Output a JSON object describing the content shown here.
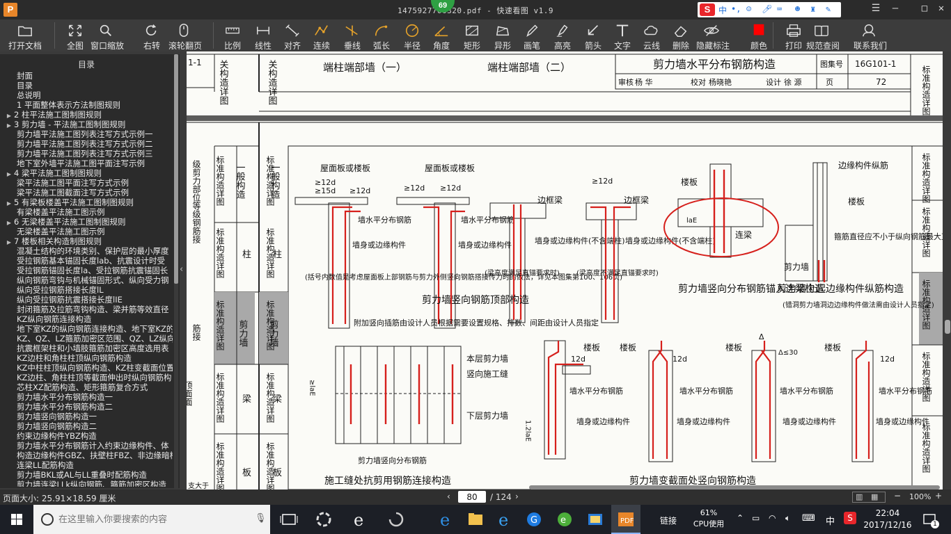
{
  "titlebar": {
    "title": "1475927706320.pdf - 快速看图 v1.9",
    "badge": "69",
    "ime_label": "中",
    "ime_punct": "•,"
  },
  "toolbar": {
    "buttons": [
      {
        "id": "open",
        "label": "打开文档",
        "icon": "folder-icon"
      },
      {
        "id": "fit",
        "label": "全图",
        "icon": "fullscreen-icon"
      },
      {
        "id": "zoomwin",
        "label": "窗口缩放",
        "icon": "magnifier-icon"
      },
      {
        "id": "rotate",
        "label": "右转",
        "icon": "rotate-icon"
      },
      {
        "id": "wheel",
        "label": "滚轮翻页",
        "icon": "mouse-icon"
      },
      {
        "id": "scale",
        "label": "比例",
        "icon": "ruler-icon"
      },
      {
        "id": "linear",
        "label": "线性",
        "icon": "linear-dim-icon"
      },
      {
        "id": "align",
        "label": "对齐",
        "icon": "aligned-dim-icon"
      },
      {
        "id": "cont",
        "label": "连续",
        "icon": "continuous-dim-icon"
      },
      {
        "id": "perp",
        "label": "垂线",
        "icon": "perpendicular-icon"
      },
      {
        "id": "arc",
        "label": "弧长",
        "icon": "arc-icon"
      },
      {
        "id": "radius",
        "label": "半径",
        "icon": "radius-icon"
      },
      {
        "id": "angle",
        "label": "角度",
        "icon": "angle-icon"
      },
      {
        "id": "rect",
        "label": "矩形",
        "icon": "rect-area-icon"
      },
      {
        "id": "irreg",
        "label": "异形",
        "icon": "irregular-area-icon"
      },
      {
        "id": "pen",
        "label": "画笔",
        "icon": "pen-icon"
      },
      {
        "id": "highlight",
        "label": "高亮",
        "icon": "highlighter-icon"
      },
      {
        "id": "arrow",
        "label": "箭头",
        "icon": "arrow-icon"
      },
      {
        "id": "text",
        "label": "文字",
        "icon": "text-icon"
      },
      {
        "id": "cloud",
        "label": "云线",
        "icon": "cloud-icon"
      },
      {
        "id": "delete",
        "label": "删除",
        "icon": "eraser-icon"
      },
      {
        "id": "hide",
        "label": "隐藏标注",
        "icon": "eye-hide-icon"
      },
      {
        "id": "color",
        "label": "颜色",
        "icon": "color-swatch-icon"
      },
      {
        "id": "print",
        "label": "打印",
        "icon": "printer-icon"
      },
      {
        "id": "spec",
        "label": "规范查阅",
        "icon": "book-icon"
      },
      {
        "id": "contact",
        "label": "联系我们",
        "icon": "support-icon"
      }
    ],
    "accent_color": "#e4a12a",
    "swatch_color": "#ff0000"
  },
  "sidebar": {
    "title": "目录",
    "items": [
      {
        "text": "封面",
        "expand": false,
        "indent": 1
      },
      {
        "text": "目录",
        "expand": false,
        "indent": 1
      },
      {
        "text": "总说明",
        "expand": false,
        "indent": 1
      },
      {
        "text": "1 平面整体表示方法制图规则",
        "expand": false,
        "indent": 1
      },
      {
        "text": "2 柱平法施工图制图规则",
        "expand": true,
        "indent": 0
      },
      {
        "text": "3 剪力墙 - 平法施工图制图规则",
        "expand": true,
        "indent": 0
      },
      {
        "text": "剪力墙平法施工图列表注写方式示例一",
        "expand": false,
        "indent": 1
      },
      {
        "text": "剪力墙平法施工图列表注写方式示例二",
        "expand": false,
        "indent": 1
      },
      {
        "text": "剪力墙平法施工图列表注写方式示例三",
        "expand": false,
        "indent": 1
      },
      {
        "text": "地下室外墙平法施工图平面注写示例",
        "expand": false,
        "indent": 1
      },
      {
        "text": "4 梁平法施工图制图规则",
        "expand": true,
        "indent": 0
      },
      {
        "text": "梁平法施工图平面注写方式示例",
        "expand": false,
        "indent": 1
      },
      {
        "text": "梁平法施工图截面注写方式示例",
        "expand": false,
        "indent": 1
      },
      {
        "text": "5 有梁板楼盖平法施工图制图规则",
        "expand": true,
        "indent": 0
      },
      {
        "text": "有梁楼盖平法施工图示例",
        "expand": false,
        "indent": 1
      },
      {
        "text": "6 无梁楼盖平法施工图制图规则",
        "expand": true,
        "indent": 0
      },
      {
        "text": "无梁楼盖平法施工图示例",
        "expand": false,
        "indent": 1
      },
      {
        "text": "7 楼板相关构造制图规则",
        "expand": true,
        "indent": 0
      },
      {
        "text": "混凝土结构的环境类别、保护层的最小厚度",
        "expand": false,
        "indent": 1
      },
      {
        "text": "受拉钢筋基本锚固长度lab、抗震设计时受",
        "expand": false,
        "indent": 1
      },
      {
        "text": "受拉钢筋锚固长度la、受拉钢筋抗震锚固长",
        "expand": false,
        "indent": 1
      },
      {
        "text": "纵向钢筋弯钩与机械锚固形式、纵向受力钢",
        "expand": false,
        "indent": 1
      },
      {
        "text": "纵向受拉钢筋搭接长度lL",
        "expand": false,
        "indent": 1
      },
      {
        "text": "纵向受拉钢筋抗震搭接长度lIE",
        "expand": false,
        "indent": 1
      },
      {
        "text": "封闭箍筋及拉筋弯钩构造、梁并筋等效直径",
        "expand": false,
        "indent": 1
      },
      {
        "text": "KZ纵向钢筋连接构造",
        "expand": false,
        "indent": 1
      },
      {
        "text": "地下室KZ的纵向钢筋连接构造、地下室KZ的",
        "expand": false,
        "indent": 1
      },
      {
        "text": "KZ、QZ、LZ箍筋加密区范围、QZ、LZ纵向钢",
        "expand": false,
        "indent": 1
      },
      {
        "text": "抗震框架柱和小墙肢箍筋加密区高度选用表",
        "expand": false,
        "indent": 1
      },
      {
        "text": "KZ边柱和角柱柱顶纵向钢筋构造",
        "expand": false,
        "indent": 1
      },
      {
        "text": "KZ中柱柱顶纵向钢筋构造、KZ柱变截面位置",
        "expand": false,
        "indent": 1
      },
      {
        "text": "KZ边柱、角柱柱顶等截面伸出时纵向钢筋构",
        "expand": false,
        "indent": 1
      },
      {
        "text": "芯柱XZ配筋构造、矩形箍筋复合方式",
        "expand": false,
        "indent": 1
      },
      {
        "text": "剪力墙水平分布钢筋构造一",
        "expand": false,
        "indent": 1
      },
      {
        "text": "剪力墙水平分布钢筋构造二",
        "expand": false,
        "indent": 1
      },
      {
        "text": "剪力墙竖向钢筋构造一",
        "expand": false,
        "indent": 1
      },
      {
        "text": "剪力墙竖向钢筋构造二",
        "expand": false,
        "indent": 1
      },
      {
        "text": "约束边缘构件YBZ构造",
        "expand": false,
        "indent": 1
      },
      {
        "text": "剪力墙水平分布钢筋计入约束边缘构件、体",
        "expand": false,
        "indent": 1
      },
      {
        "text": "构造边缘构件GBZ、扶壁柱FBZ、非边缘暗柱",
        "expand": false,
        "indent": 1
      },
      {
        "text": "连梁LL配筋构造",
        "expand": false,
        "indent": 1
      },
      {
        "text": "剪力墙BKL或AL与LL重叠时配筋构造",
        "expand": false,
        "indent": 1
      },
      {
        "text": "剪力墙连梁LLk纵向钢筋、箍筋加密区构造",
        "expand": false,
        "indent": 1
      }
    ]
  },
  "drawing_top": {
    "title_block": {
      "title": "剪力墙水平分布钢筋构造",
      "atlas_label": "图集号",
      "atlas_no": "16G101-1",
      "review_label": "审核",
      "review_name": "杨 华",
      "check_label": "校对",
      "check_name": "杨晓艳",
      "design_label": "设计",
      "design_name": "徐 源",
      "page_label": "页",
      "page_no": "72"
    },
    "section_a": "端柱端部墙（一）",
    "section_b": "端柱端部墙（二）",
    "left_col": "关构造详图",
    "left_col2": "墙",
    "left_num": "1-1",
    "right_col": "标准构造详图"
  },
  "drawing_main": {
    "side_labels": {
      "general": "一般构造",
      "std_detail": "标准构造详图",
      "column": "柱",
      "shear_wall": "剪力墙",
      "beam": "梁",
      "slab": "板",
      "left_notes": "级剪力部位等级钢筋接",
      "left_notes2": "筋接",
      "left_notes3": "顶面面",
      "left_bottom": "支大于"
    },
    "callouts": {
      "roof_slab": "屋面板或楼板",
      "dim_12d": "≥12d",
      "dim_15d": "≥15d",
      "ge_12d": "≥12d",
      "wall_horiz": "墙水平分布钢筋",
      "wall_or_edge": "墙身或边缘构件",
      "frame_beam": "边框梁",
      "wall_or_edge2": "墙身或边缘构件(不含端柱)",
      "note_bracket": "(括号内数值是考虑屋面板上部钢筋与剪力外侧竖向钢筋搭接传力时的做法，详见本图集第100、106页)",
      "beam_height_ok": "(梁高度满足直锚要求时)",
      "beam_height_no": "(梁高度不满足直锚要求时)",
      "top_title": "剪力墙竖向钢筋顶部构造",
      "slab": "楼板",
      "coupling_beam": "连梁",
      "anchor_title": "剪力墙竖向分布钢筋锚入连梁构造",
      "edge_long": "边缘构件纵筋",
      "stirrup_note": "箍筋直径应不小于纵向钢筋最大直径的0.25倍，间距不大于100",
      "shear_wall": "剪力墙",
      "wall_edge_title": "剪力墙上起边缘构件纵筋构造",
      "wall_edge_note": "(错洞剪力墙洞边边缘构件做法需由设计人员指定)",
      "extra_dowel": "附加竖向插筋由设计人员根据需要设置规格、排数、间距由设计人员指定",
      "upper_wall": "本层剪力墙",
      "vert_joint": "竖向施工缝",
      "lower_wall": "下层剪力墙",
      "vert_dist": "剪力墙竖向分布钢筋",
      "joint_title": "施工缝处抗剪用钢筋连接构造",
      "slab2": "楼板",
      "dim_12d2": "12d",
      "wall_horiz2": "墙水平分布钢筋",
      "wall_or_edge3": "墙身或边缘构件",
      "delta": "Δ",
      "delta_limit": "Δ≤30",
      "lae": "1.2laE",
      "ge_lae": "≥laE",
      "la_e": "laE",
      "var_title": "剪力墙变截面处竖向钢筋构造"
    },
    "annotation_color": "#d6201c"
  },
  "statusbar": {
    "page_size": "页面大小: 25.91×18.59 厘米",
    "current_page": "80",
    "total_pages": "/ 124",
    "zoom": "100%"
  },
  "taskbar": {
    "search_placeholder": "在这里输入你要搜索的内容",
    "link_label": "链接",
    "cpu_pct": "61%",
    "cpu_label": "CPU使用",
    "ime": "中",
    "time": "22:04",
    "date": "2017/12/16",
    "notif_count": "1"
  }
}
